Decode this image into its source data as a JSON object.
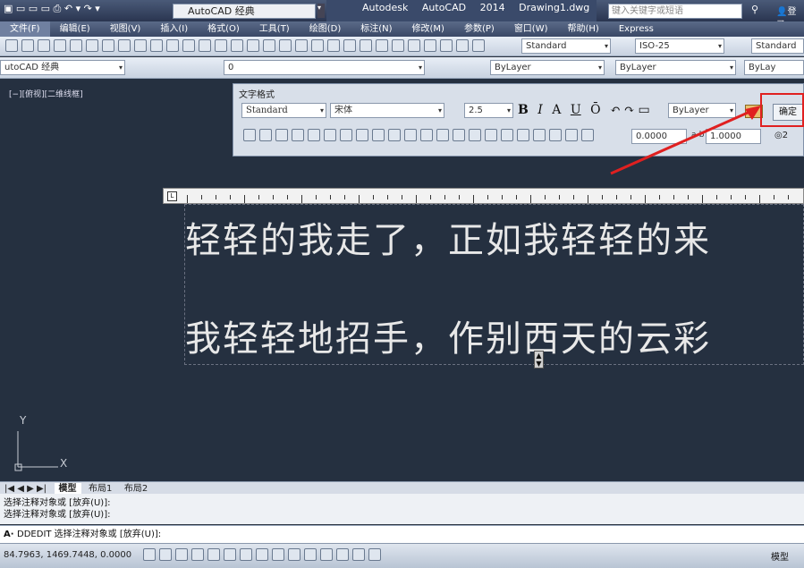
{
  "titlebar": {
    "workspace": "AutoCAD 经典",
    "app_title": "Autodesk AutoCAD 2014",
    "doc_title": "Drawing1.dwg",
    "search_placeholder": "键入关键字或短语",
    "login": "登录"
  },
  "menu": [
    "文件(F)",
    "编辑(E)",
    "视图(V)",
    "插入(I)",
    "格式(O)",
    "工具(T)",
    "绘图(D)",
    "标注(N)",
    "修改(M)",
    "参数(P)",
    "窗口(W)",
    "帮助(H)",
    "Express"
  ],
  "toolbar2": {
    "text_style": "Standard",
    "dim_style": "ISO-25",
    "table_style": "Standard"
  },
  "toolbar3": {
    "workspace": "utoCAD 经典",
    "layer": "0",
    "color": "ByLayer",
    "linetype": "ByLayer",
    "lineweight": "ByLay"
  },
  "viewport": {
    "label": "[−][俯视][二维线框]",
    "axis_y": "Y",
    "axis_x": "X"
  },
  "text_format": {
    "title": "文字格式",
    "style": "Standard",
    "font": "宋体",
    "height": "2.5",
    "bold": "B",
    "italic": "I",
    "strike": "A",
    "underline": "U",
    "overline": "Ō",
    "color": "ByLayer",
    "ok": "确定",
    "oblique": "0.0000",
    "tracking_prefix": "a-b",
    "tracking": "1.0000",
    "width_factor": "2"
  },
  "mtext": {
    "line1": "轻轻的我走了，正如我轻轻的来",
    "line2": "我轻轻地招手，作别西天的云彩"
  },
  "tabs": [
    "模型",
    "布局1",
    "布局2"
  ],
  "command": {
    "history1": "选择注释对象或 [放弃(U)]:",
    "history2": "选择注释对象或 [放弃(U)]:",
    "prompt": "DDEDIT 选择注释对象或 [放弃(U)]:"
  },
  "status": {
    "coords": "84.7963, 1469.7448, 0.0000",
    "model": "模型"
  }
}
